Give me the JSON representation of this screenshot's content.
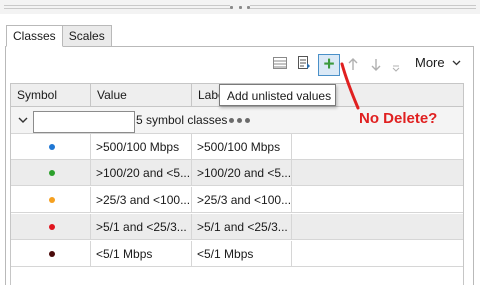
{
  "tabs": [
    "Classes",
    "Scales"
  ],
  "active_tab": "Classes",
  "toolbar": {
    "more_label": "More",
    "icons": [
      "list-view-icon",
      "import-icon",
      "add-icon",
      "move-up-icon",
      "move-down-icon",
      "sort-icon"
    ]
  },
  "tooltip": "Add unlisted values",
  "annotation": {
    "text": "No Delete?",
    "color": "#e02020"
  },
  "table": {
    "columns": [
      "Symbol",
      "Value",
      "Label"
    ],
    "group": {
      "input_value": "",
      "label": "5 symbol classes"
    },
    "rows": [
      {
        "symbol_color": "#1f77d4",
        "value": ">500/100 Mbps",
        "label": ">500/100 Mbps"
      },
      {
        "symbol_color": "#2ca02c",
        "value": ">100/20 and <5...",
        "label": ">100/20 and <5..."
      },
      {
        "symbol_color": "#f5a020",
        "value": ">25/3 and <100...",
        "label": ">25/3 and <100..."
      },
      {
        "symbol_color": "#e0141e",
        "value": ">5/1 and <25/3...",
        "label": ">5/1 and <25/3..."
      },
      {
        "symbol_color": "#4a0a0a",
        "value": "<5/1 Mbps",
        "label": "<5/1 Mbps"
      }
    ]
  }
}
